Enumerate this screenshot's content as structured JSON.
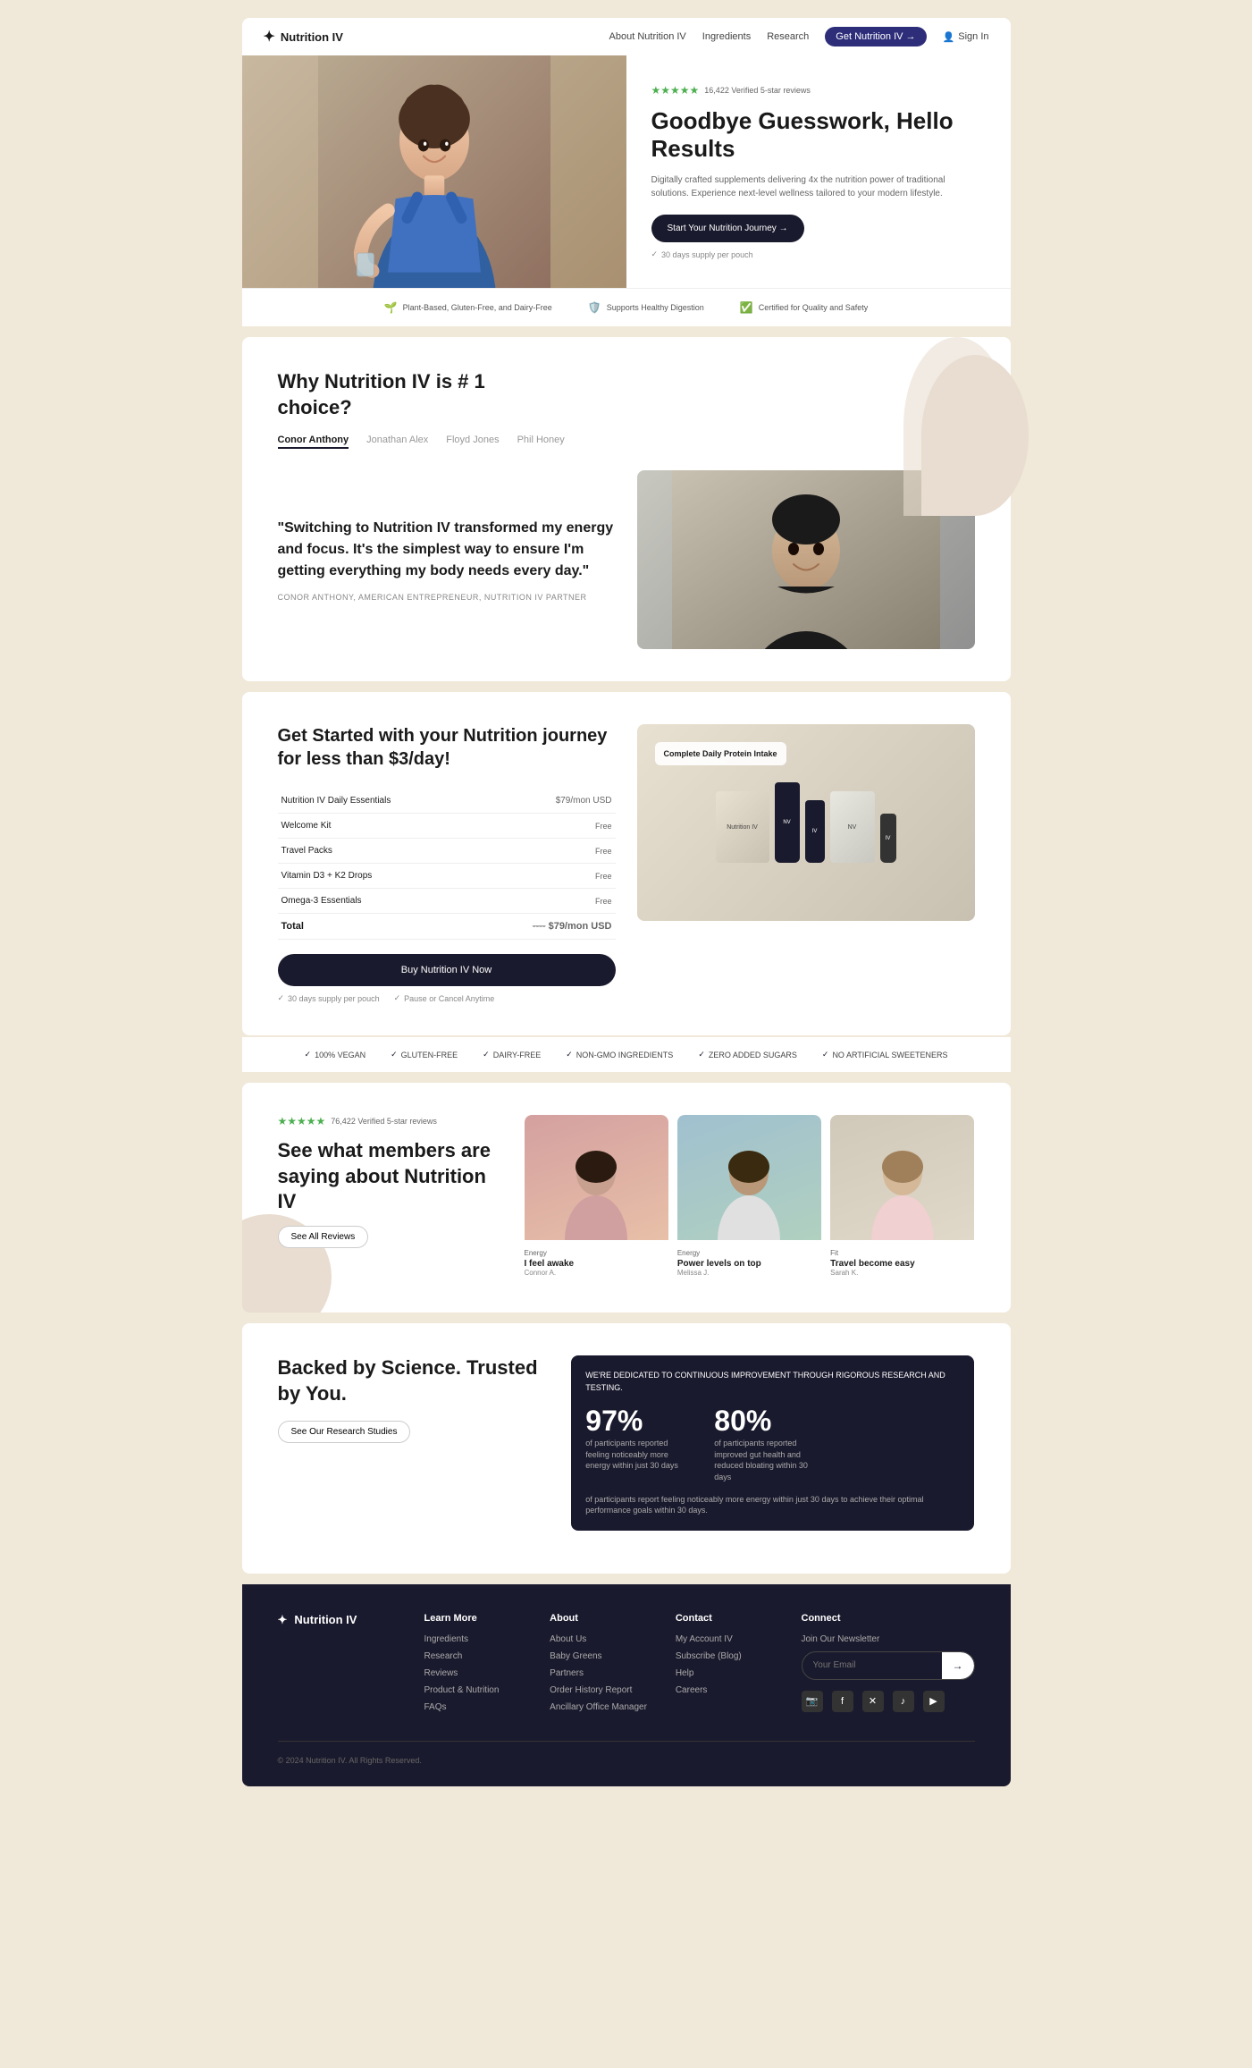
{
  "nav": {
    "logo": "Nutrition IV",
    "links": [
      "About Nutrition IV",
      "Ingredients",
      "Research"
    ],
    "cta": "Get Nutrition IV →",
    "sign_in": "Sign In"
  },
  "hero": {
    "stars": "★★★★★",
    "review_count": "16,422 Verified 5-star reviews",
    "title": "Goodbye Guesswork, Hello Results",
    "description": "Digitally crafted supplements delivering 4x the nutrition power of traditional solutions. Experience next-level wellness tailored to your modern lifestyle.",
    "cta": "Start Your Nutrition Journey →",
    "guarantee": "30 days supply per pouch"
  },
  "trust_bar": {
    "items": [
      {
        "icon": "🌱",
        "text": "Plant-Based, Gluten-Free, and Dairy-Free"
      },
      {
        "icon": "🛡️",
        "text": "Supports Healthy Digestion"
      },
      {
        "icon": "✅",
        "text": "Certified for Quality and Safety"
      }
    ]
  },
  "why": {
    "title": "Why Nutrition IV is # 1 choice?",
    "tabs": [
      "Conor Anthony",
      "Jonathan Alex",
      "Floyd Jones",
      "Phil Honey"
    ],
    "active_tab": "Conor Anthony",
    "quote": "\"Switching to Nutrition IV transformed my energy and focus. It's the simplest way to ensure I'm getting everything my body needs every day.\"",
    "author": "CONOR ANTHONY, AMERICAN ENTREPRENEUR, NUTRITION IV PARTNER"
  },
  "pricing": {
    "title": "Get Started with your Nutrition journey for less than $3/day!",
    "rows": [
      {
        "item": "Nutrition IV Daily Essentials",
        "price": "$79/mon USD"
      },
      {
        "item": "Welcome Kit",
        "price": "Free"
      },
      {
        "item": "Travel Packs",
        "price": "Free"
      },
      {
        "item": "Vitamin D3 + K2 Drops",
        "price": "Free"
      },
      {
        "item": "Omega-3 Essentials",
        "price": "Free"
      },
      {
        "item": "Total",
        "original": "----",
        "price": "$79/mon USD"
      }
    ],
    "cta": "Buy Nutrition IV Now",
    "footer_1": "30 days supply per pouch",
    "footer_2": "Pause or Cancel Anytime",
    "product_label": "Complete Daily Protein Intake"
  },
  "badges": {
    "items": [
      "100% VEGAN",
      "GLUTEN-FREE",
      "DAIRY-FREE",
      "NON-GMO INGREDIENTS",
      "ZERO ADDED SUGARS",
      "NO ARTIFICIAL SWEETENERS"
    ]
  },
  "reviews": {
    "stars": "★★★★★",
    "review_count": "76,422 Verified 5-star reviews",
    "title": "See what members are saying about Nutrition IV",
    "see_all": "See All Reviews",
    "cards": [
      {
        "tag": "Energy",
        "caption": "I feel awake",
        "detail": "Connor A."
      },
      {
        "tag": "Energy",
        "caption": "Power levels on top",
        "detail": "Melissa J."
      },
      {
        "tag": "Fit",
        "caption": "Travel become easy",
        "detail": "Sarah K."
      }
    ]
  },
  "science": {
    "title": "Backed by Science. Trusted by You.",
    "cta": "See Our Research Studies",
    "banner": "WE'RE DEDICATED TO CONTINUOUS IMPROVEMENT THROUGH RIGOROUS RESEARCH AND TESTING.",
    "stat_1": "97%",
    "stat_1_desc": "of participants reported feeling noticeably more energy within just 30 days",
    "stat_2": "80%",
    "stat_2_desc": "of participants reported improved gut health and reduced bloating within 30 days",
    "footnote": "of participants report feeling noticeably more energy within just 30 days to achieve their optimal performance goals within 30 days."
  },
  "footer": {
    "logo": "Nutrition IV",
    "columns": [
      {
        "title": "Learn More",
        "links": [
          "Ingredients",
          "Research",
          "Reviews",
          "Product & Nutrition",
          "FAQs"
        ]
      },
      {
        "title": "About",
        "links": [
          "About Us",
          "Baby Greens",
          "Partners",
          "Order History Report",
          "Ancillary Office Manager"
        ]
      },
      {
        "title": "Contact",
        "links": [
          "My Account IV",
          "Subscribe (Blog)",
          "Help",
          "Careers"
        ]
      },
      {
        "title": "Connect",
        "newsletter_label": "Join Our Newsletter",
        "input_placeholder": "Your Email",
        "social_icons": [
          "📷",
          "f",
          "✕",
          "♪",
          "▶"
        ]
      }
    ],
    "copyright": "Nutrition IV",
    "bottom_text": "© 2024 Nutrition IV. All Rights Reserved."
  }
}
